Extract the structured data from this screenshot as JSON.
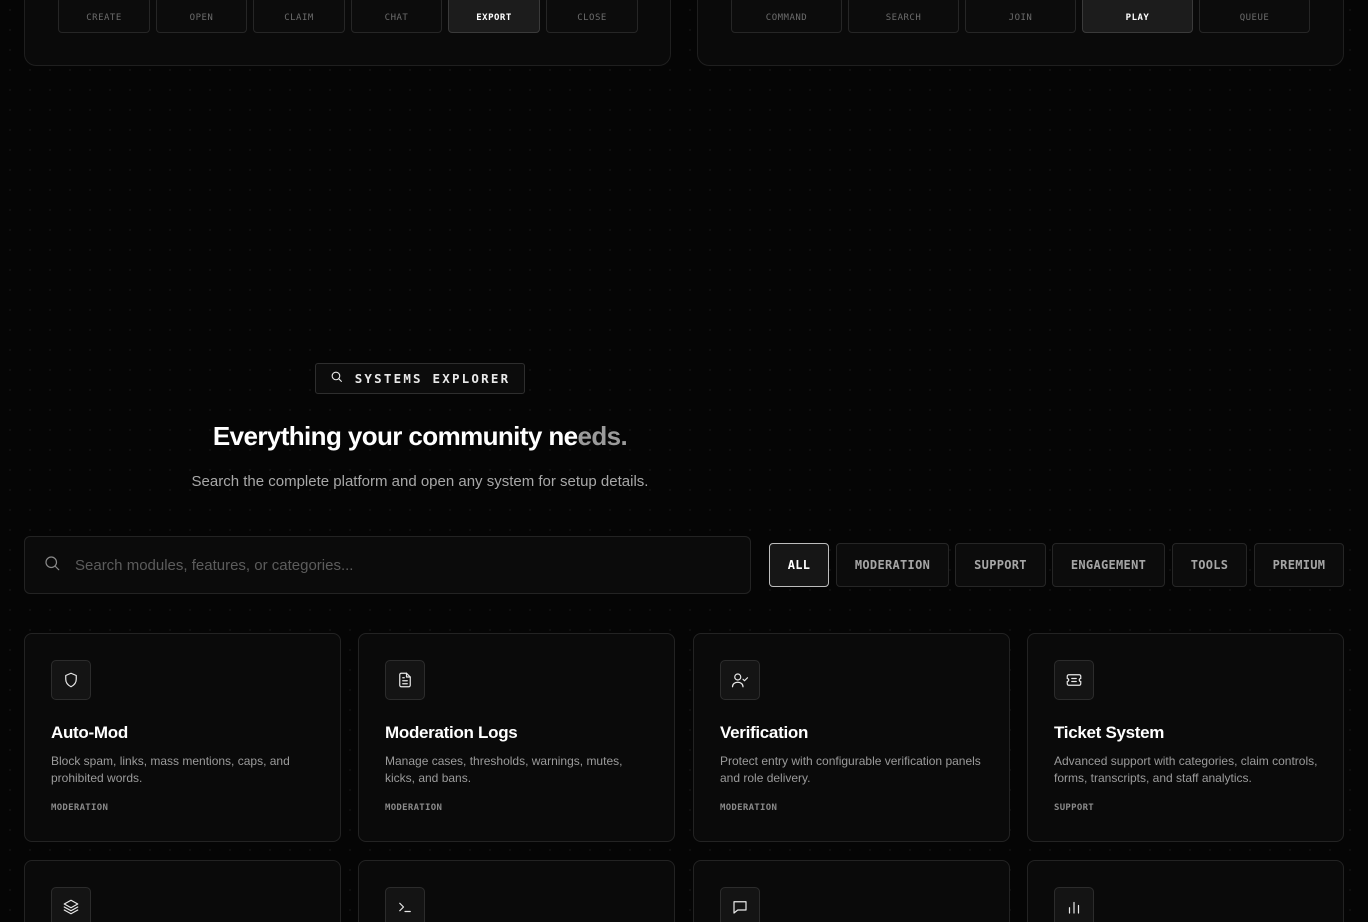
{
  "top_panels": {
    "left_buttons": [
      "CREATE",
      "OPEN",
      "CLAIM",
      "CHAT",
      "EXPORT",
      "CLOSE"
    ],
    "right_buttons": [
      "COMMAND",
      "SEARCH",
      "JOIN",
      "PLAY",
      "QUEUE"
    ]
  },
  "explorer": {
    "badge": "SYSTEMS EXPLORER",
    "headline_main": "Everything your community ne",
    "headline_fade": "eds.",
    "subline": "Search the complete platform and open any system for setup details."
  },
  "search": {
    "placeholder": "Search modules, features, or categories...",
    "value": ""
  },
  "filters": [
    "ALL",
    "MODERATION",
    "SUPPORT",
    "ENGAGEMENT",
    "TOOLS",
    "PREMIUM"
  ],
  "cards": [
    {
      "icon": "shield-icon",
      "title": "Auto-Mod",
      "desc": "Block spam, links, mass mentions, caps, and prohibited words.",
      "tag": "MODERATION"
    },
    {
      "icon": "document-icon",
      "title": "Moderation Logs",
      "desc": "Manage cases, thresholds, warnings, mutes, kicks, and bans.",
      "tag": "MODERATION"
    },
    {
      "icon": "user-check-icon",
      "title": "Verification",
      "desc": "Protect entry with configurable verification panels and role delivery.",
      "tag": "MODERATION"
    },
    {
      "icon": "ticket-icon",
      "title": "Ticket System",
      "desc": "Advanced support with categories, claim controls, forms, transcripts, and staff analytics.",
      "tag": "SUPPORT"
    }
  ],
  "partial_cards_icons": [
    "layers-icon",
    "terminal-icon",
    "message-icon",
    "bar-chart-icon"
  ]
}
